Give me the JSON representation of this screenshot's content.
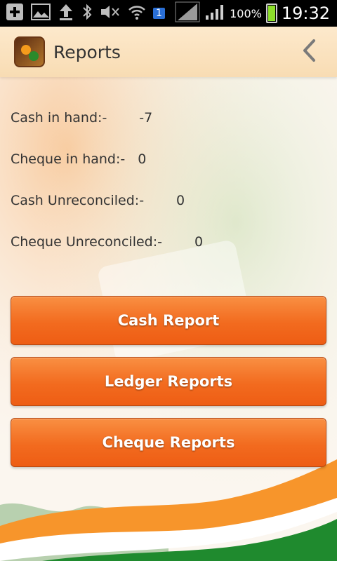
{
  "status_bar": {
    "sim_label": "1",
    "battery_pct": "100%",
    "time": "19:32"
  },
  "header": {
    "title": "Reports",
    "logo": "app-logo-icon",
    "back_icon": "chevron-left-icon"
  },
  "summary": [
    {
      "label": "Cash in hand:-",
      "value": "-7"
    },
    {
      "label": "Cheque in hand:-",
      "value": "0"
    },
    {
      "label": "Cash Unreconciled:-",
      "value": "0"
    },
    {
      "label": "Cheque Unreconciled:-",
      "value": "0"
    }
  ],
  "buttons": {
    "cash_report": "Cash Report",
    "ledger_reports": "Ledger Reports",
    "cheque_reports": "Cheque Reports"
  },
  "colors": {
    "button_orange": "#f26b1f",
    "header_bg": "#fde9cc",
    "saffron": "#f7952b",
    "green": "#1f8a2e"
  }
}
